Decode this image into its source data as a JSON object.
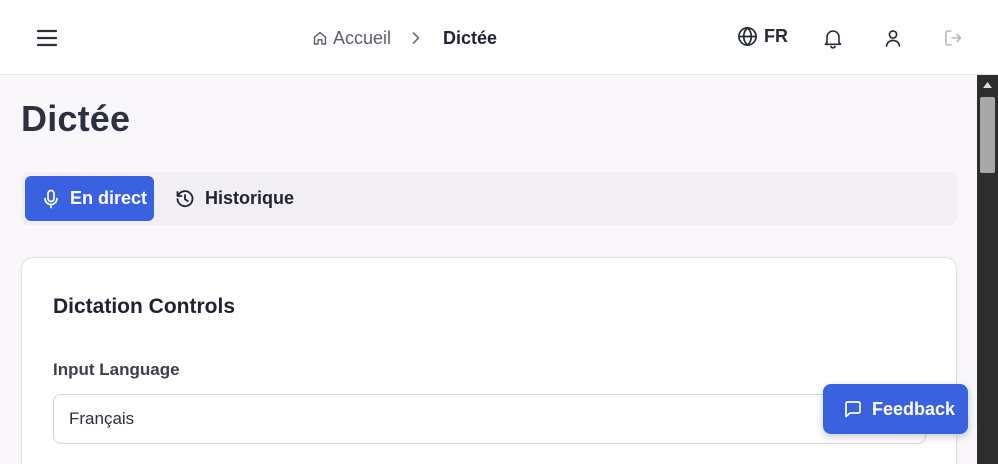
{
  "header": {
    "breadcrumb": {
      "home": "Accueil",
      "current": "Dictée"
    },
    "language": "FR"
  },
  "page": {
    "title": "Dictée"
  },
  "tabs": [
    {
      "label": "En direct",
      "active": true
    },
    {
      "label": "Historique",
      "active": false
    }
  ],
  "card": {
    "title": "Dictation Controls",
    "input_language": {
      "label": "Input Language",
      "value": "Français"
    }
  },
  "feedback": {
    "label": "Feedback"
  },
  "colors": {
    "accent": "#3a62e0",
    "background": "#f9f7f9"
  },
  "icons": [
    "menu-icon",
    "home-icon",
    "chevron-right-icon",
    "globe-icon",
    "bell-icon",
    "user-icon",
    "logout-icon",
    "microphone-icon",
    "history-icon",
    "message-square-icon"
  ]
}
